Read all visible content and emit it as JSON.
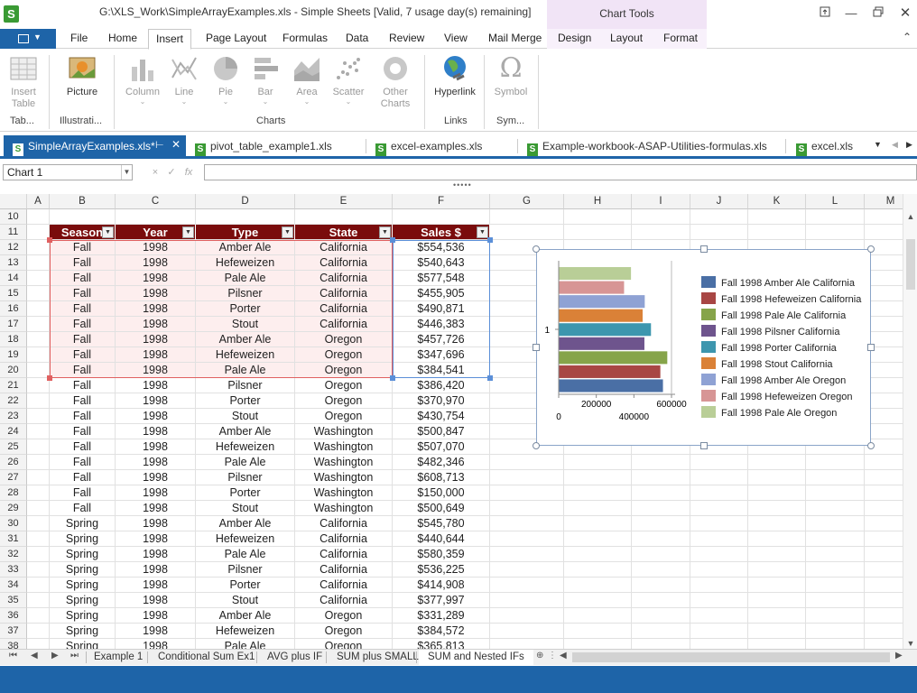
{
  "window": {
    "title": "G:\\XLS_Work\\SimpleArrayExamples.xls - Simple Sheets [Valid, 7 usage day(s) remaining]",
    "contextual_group": "Chart Tools",
    "controls": [
      "restore-to-top",
      "minimize",
      "maximize",
      "close"
    ]
  },
  "ribbon_tabs": [
    "File",
    "Home",
    "Insert",
    "Page Layout",
    "Formulas",
    "Data",
    "Review",
    "View",
    "Mail Merge",
    "Design",
    "Layout",
    "Format"
  ],
  "active_ribbon_tab": "Insert",
  "ribbon": {
    "insert_table": "Insert\nTable",
    "picture": "Picture",
    "column": "Column",
    "line": "Line",
    "pie": "Pie",
    "bar": "Bar",
    "area": "Area",
    "scatter": "Scatter",
    "other_charts": "Other\nCharts",
    "hyperlink": "Hyperlink",
    "symbol": "Symbol",
    "groups": {
      "tables": "Tab...",
      "illustrations": "Illustrati...",
      "charts": "Charts",
      "links": "Links",
      "symbols": "Sym..."
    }
  },
  "doc_tabs": [
    {
      "label": "SimpleArrayExamples.xls*",
      "active": true
    },
    {
      "label": "pivot_table_example1.xls",
      "active": false
    },
    {
      "label": "excel-examples.xls",
      "active": false
    },
    {
      "label": "Example-workbook-ASAP-Utilities-formulas.xls",
      "active": false
    },
    {
      "label": "excel.xls",
      "active": false
    }
  ],
  "formula_bar": {
    "name_box": "Chart 1",
    "cancel": "×",
    "enter": "✓",
    "fx": "fx",
    "formula": ""
  },
  "columns": [
    "A",
    "B",
    "C",
    "D",
    "E",
    "F",
    "G",
    "H",
    "I",
    "J",
    "K",
    "L",
    "M"
  ],
  "table_headers": [
    "Season",
    "Year",
    "Type",
    "State",
    "Sales $"
  ],
  "rows": [
    {
      "n": "10",
      "cells": null
    },
    {
      "n": "11",
      "cells": "header"
    },
    {
      "n": "12",
      "cells": [
        "Fall",
        "1998",
        "Amber Ale",
        "California",
        "$554,536"
      ]
    },
    {
      "n": "13",
      "cells": [
        "Fall",
        "1998",
        "Hefeweizen",
        "California",
        "$540,643"
      ]
    },
    {
      "n": "14",
      "cells": [
        "Fall",
        "1998",
        "Pale Ale",
        "California",
        "$577,548"
      ]
    },
    {
      "n": "15",
      "cells": [
        "Fall",
        "1998",
        "Pilsner",
        "California",
        "$455,905"
      ]
    },
    {
      "n": "16",
      "cells": [
        "Fall",
        "1998",
        "Porter",
        "California",
        "$490,871"
      ]
    },
    {
      "n": "17",
      "cells": [
        "Fall",
        "1998",
        "Stout",
        "California",
        "$446,383"
      ]
    },
    {
      "n": "18",
      "cells": [
        "Fall",
        "1998",
        "Amber Ale",
        "Oregon",
        "$457,726"
      ]
    },
    {
      "n": "19",
      "cells": [
        "Fall",
        "1998",
        "Hefeweizen",
        "Oregon",
        "$347,696"
      ]
    },
    {
      "n": "20",
      "cells": [
        "Fall",
        "1998",
        "Pale Ale",
        "Oregon",
        "$384,541"
      ]
    },
    {
      "n": "21",
      "cells": [
        "Fall",
        "1998",
        "Pilsner",
        "Oregon",
        "$386,420"
      ]
    },
    {
      "n": "22",
      "cells": [
        "Fall",
        "1998",
        "Porter",
        "Oregon",
        "$370,970"
      ]
    },
    {
      "n": "23",
      "cells": [
        "Fall",
        "1998",
        "Stout",
        "Oregon",
        "$430,754"
      ]
    },
    {
      "n": "24",
      "cells": [
        "Fall",
        "1998",
        "Amber Ale",
        "Washington",
        "$500,847"
      ]
    },
    {
      "n": "25",
      "cells": [
        "Fall",
        "1998",
        "Hefeweizen",
        "Washington",
        "$507,070"
      ]
    },
    {
      "n": "26",
      "cells": [
        "Fall",
        "1998",
        "Pale Ale",
        "Washington",
        "$482,346"
      ]
    },
    {
      "n": "27",
      "cells": [
        "Fall",
        "1998",
        "Pilsner",
        "Washington",
        "$608,713"
      ]
    },
    {
      "n": "28",
      "cells": [
        "Fall",
        "1998",
        "Porter",
        "Washington",
        "$150,000"
      ]
    },
    {
      "n": "29",
      "cells": [
        "Fall",
        "1998",
        "Stout",
        "Washington",
        "$500,649"
      ]
    },
    {
      "n": "30",
      "cells": [
        "Spring",
        "1998",
        "Amber Ale",
        "California",
        "$545,780"
      ]
    },
    {
      "n": "31",
      "cells": [
        "Spring",
        "1998",
        "Hefeweizen",
        "California",
        "$440,644"
      ]
    },
    {
      "n": "32",
      "cells": [
        "Spring",
        "1998",
        "Pale Ale",
        "California",
        "$580,359"
      ]
    },
    {
      "n": "33",
      "cells": [
        "Spring",
        "1998",
        "Pilsner",
        "California",
        "$536,225"
      ]
    },
    {
      "n": "34",
      "cells": [
        "Spring",
        "1998",
        "Porter",
        "California",
        "$414,908"
      ]
    },
    {
      "n": "35",
      "cells": [
        "Spring",
        "1998",
        "Stout",
        "California",
        "$377,997"
      ]
    },
    {
      "n": "36",
      "cells": [
        "Spring",
        "1998",
        "Amber Ale",
        "Oregon",
        "$331,289"
      ]
    },
    {
      "n": "37",
      "cells": [
        "Spring",
        "1998",
        "Hefeweizen",
        "Oregon",
        "$384,572"
      ]
    },
    {
      "n": "38",
      "cells": [
        "Spring",
        "1998",
        "Pale Ale",
        "Oregon",
        "$365,813"
      ]
    }
  ],
  "chart_data": {
    "type": "bar",
    "orientation": "horizontal",
    "categories": [
      "1"
    ],
    "series": [
      {
        "name": "Fall 1998 Amber Ale California",
        "values": [
          554536
        ],
        "color": "#4a6fa5"
      },
      {
        "name": "Fall 1998 Hefeweizen California",
        "values": [
          540643
        ],
        "color": "#a84644"
      },
      {
        "name": "Fall 1998 Pale Ale California",
        "values": [
          577548
        ],
        "color": "#86a44a"
      },
      {
        "name": "Fall 1998 Pilsner California",
        "values": [
          455905
        ],
        "color": "#6e548d"
      },
      {
        "name": "Fall 1998 Porter California",
        "values": [
          490871
        ],
        "color": "#3d96ae"
      },
      {
        "name": "Fall 1998 Stout California",
        "values": [
          446383
        ],
        "color": "#da8137"
      },
      {
        "name": "Fall 1998 Amber Ale Oregon",
        "values": [
          457726
        ],
        "color": "#8fa2d4"
      },
      {
        "name": "Fall 1998 Hefeweizen Oregon",
        "values": [
          347696
        ],
        "color": "#d79595"
      },
      {
        "name": "Fall 1998 Pale Ale Oregon",
        "values": [
          384541
        ],
        "color": "#b9ce97"
      }
    ],
    "xlim": [
      0,
      600000
    ],
    "x_ticks": [
      "0",
      "200000",
      "400000",
      "600000"
    ],
    "grid": false,
    "legend": "right"
  },
  "sheet_tabs": [
    {
      "label": "Example 1",
      "active": false
    },
    {
      "label": "Conditional Sum Ex1",
      "active": false
    },
    {
      "label": "AVG plus IF",
      "active": false
    },
    {
      "label": "SUM plus SMALL",
      "active": false
    },
    {
      "label": "SUM and Nested IFs",
      "active": true
    }
  ],
  "colors": {
    "accent": "#1e64a8",
    "table_header": "#7a0c0c",
    "contextual_tab": "#f1e4f6",
    "app_logo": "#3a9a34"
  }
}
